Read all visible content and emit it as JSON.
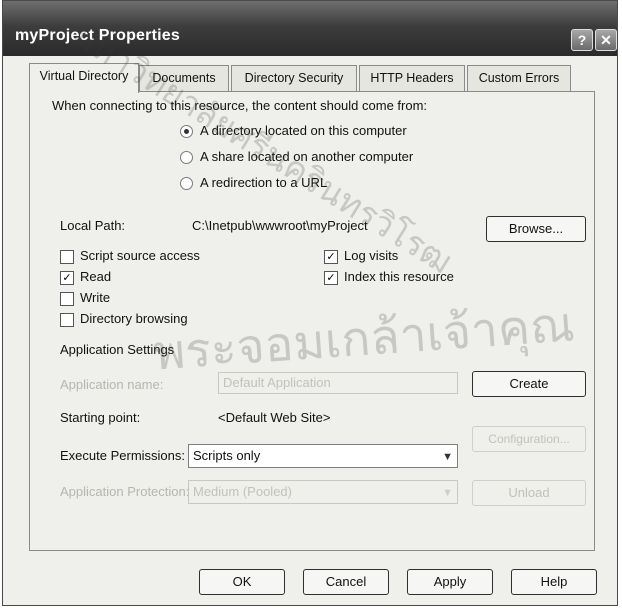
{
  "window": {
    "title": "myProject Properties",
    "help_glyph": "?",
    "close_glyph": "✕"
  },
  "tabs": [
    "Virtual Directory",
    "Documents",
    "Directory Security",
    "HTTP Headers",
    "Custom Errors"
  ],
  "content_source": {
    "heading": "When connecting to this resource, the content should come from:",
    "options": [
      "A directory located on this computer",
      "A share located on another computer",
      "A redirection to a URL"
    ],
    "selected_index": 0
  },
  "local_path": {
    "label": "Local Path:",
    "value": "C:\\Inetpub\\wwwroot\\myProject",
    "browse": "Browse..."
  },
  "permissions": {
    "script_source_access": {
      "label": "Script source access",
      "checked": false
    },
    "read": {
      "label": "Read",
      "checked": true
    },
    "write": {
      "label": "Write",
      "checked": false
    },
    "directory_browsing": {
      "label": "Directory browsing",
      "checked": false
    },
    "log_visits": {
      "label": "Log visits",
      "checked": true
    },
    "index_resource": {
      "label": "Index this resource",
      "checked": true
    }
  },
  "app_settings": {
    "heading": "Application Settings",
    "app_name_label": "Application name:",
    "app_name_value": "Default Application",
    "create": "Create",
    "starting_point_label": "Starting point:",
    "starting_point_value": "<Default Web Site>",
    "configuration": "Configuration...",
    "exec_label": "Execute Permissions:",
    "exec_value": "Scripts only",
    "protection_label": "Application Protection:",
    "protection_value": "Medium (Pooled)",
    "unload": "Unload"
  },
  "footer": {
    "ok": "OK",
    "cancel": "Cancel",
    "apply": "Apply",
    "help": "Help"
  },
  "watermark": {
    "text": "มหาวิทยาลัยศรีนครินทรวิโรฒ",
    "text2": "พระจอมเกล้าเจ้าคุณ"
  }
}
